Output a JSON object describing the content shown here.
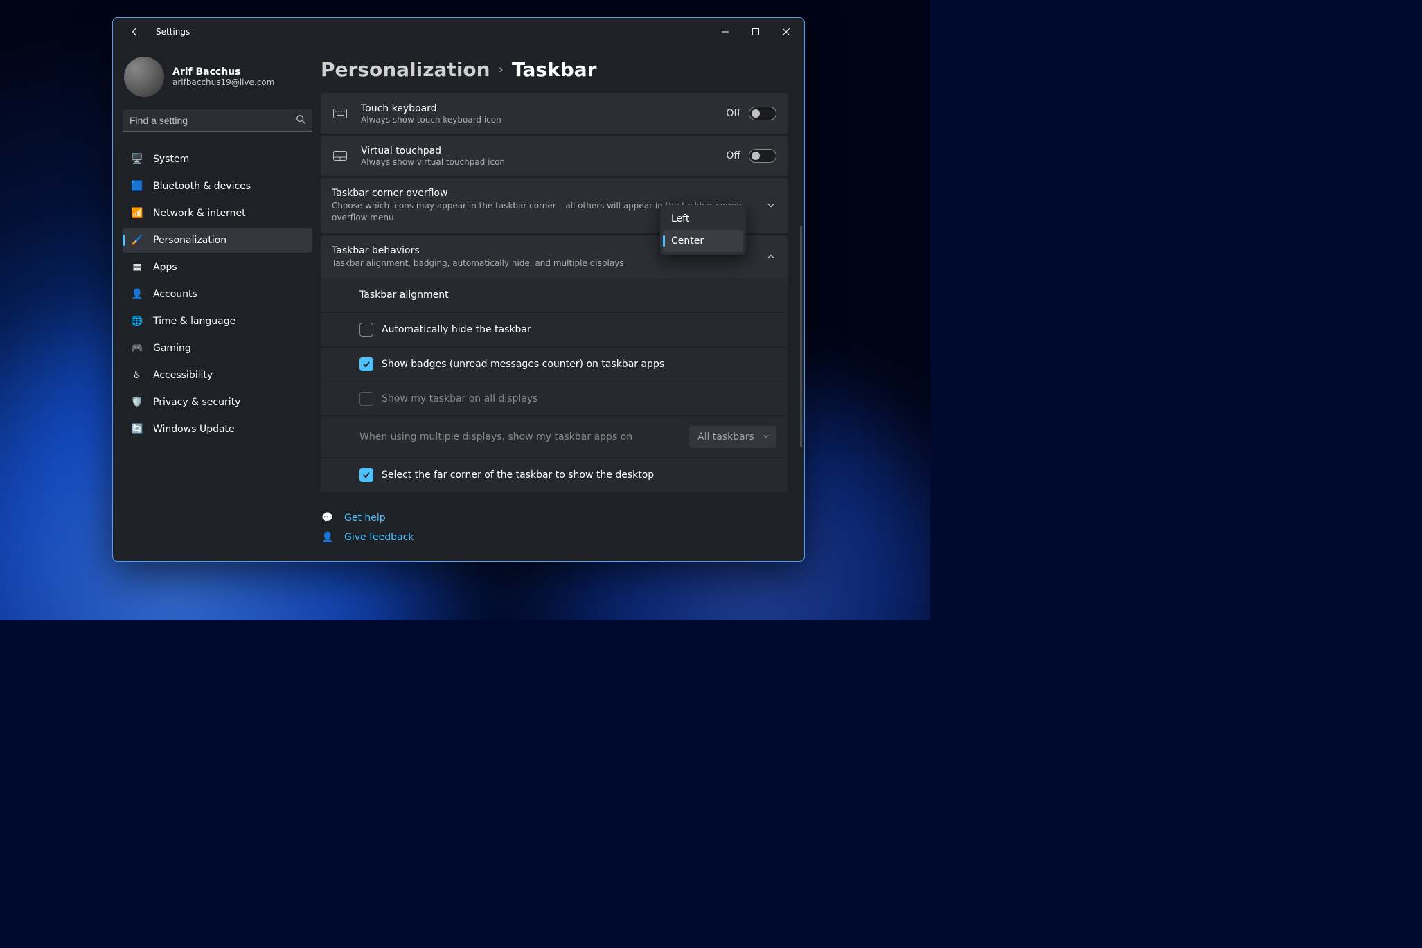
{
  "window": {
    "title": "Settings"
  },
  "profile": {
    "name": "Arif Bacchus",
    "email": "arifbacchus19@live.com"
  },
  "search": {
    "placeholder": "Find a setting"
  },
  "nav": [
    {
      "id": "system",
      "label": "System"
    },
    {
      "id": "bluetooth",
      "label": "Bluetooth & devices"
    },
    {
      "id": "network",
      "label": "Network & internet"
    },
    {
      "id": "personalization",
      "label": "Personalization",
      "active": true
    },
    {
      "id": "apps",
      "label": "Apps"
    },
    {
      "id": "accounts",
      "label": "Accounts"
    },
    {
      "id": "time",
      "label": "Time & language"
    },
    {
      "id": "gaming",
      "label": "Gaming"
    },
    {
      "id": "accessibility",
      "label": "Accessibility"
    },
    {
      "id": "privacy",
      "label": "Privacy & security"
    },
    {
      "id": "update",
      "label": "Windows Update"
    }
  ],
  "breadcrumb": {
    "parent": "Personalization",
    "current": "Taskbar"
  },
  "toggles": {
    "touch_keyboard": {
      "title": "Touch keyboard",
      "sub": "Always show touch keyboard icon",
      "state": "Off"
    },
    "virtual_touchpad": {
      "title": "Virtual touchpad",
      "sub": "Always show virtual touchpad icon",
      "state": "Off"
    }
  },
  "overflow": {
    "title": "Taskbar corner overflow",
    "sub": "Choose which icons may appear in the taskbar corner – all others will appear in the taskbar corner overflow menu"
  },
  "behaviors": {
    "title": "Taskbar behaviors",
    "sub": "Taskbar alignment, badging, automatically hide, and multiple displays",
    "alignment_label": "Taskbar alignment",
    "alignment_options": [
      "Left",
      "Center"
    ],
    "alignment_selected": "Center",
    "auto_hide": "Automatically hide the taskbar",
    "badges": "Show badges (unread messages counter) on taskbar apps",
    "all_displays": "Show my taskbar on all displays",
    "multi_label": "When using multiple displays, show my taskbar apps on",
    "multi_value": "All taskbars",
    "far_corner": "Select the far corner of the taskbar to show the desktop"
  },
  "links": {
    "help": "Get help",
    "feedback": "Give feedback"
  }
}
